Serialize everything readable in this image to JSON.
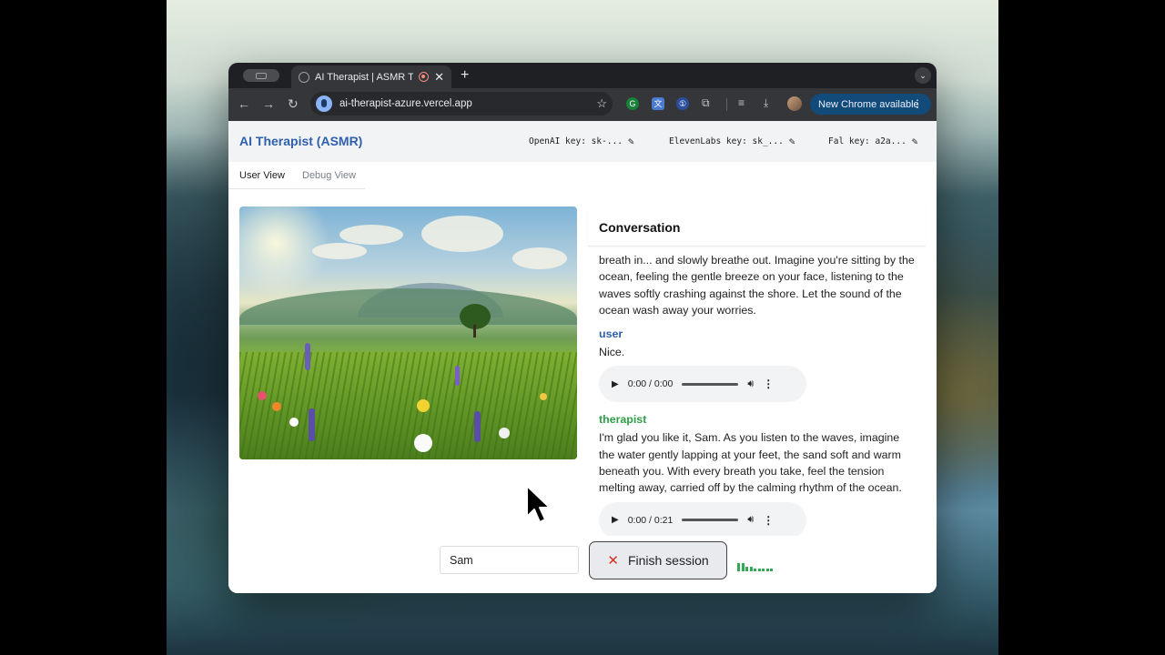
{
  "browser": {
    "tab_title": "AI Therapist | ASMR Thera",
    "url": "ai-therapist-azure.vercel.app",
    "update_label": "New Chrome available"
  },
  "app": {
    "title": "AI Therapist (ASMR)",
    "keys": {
      "openai": "OpenAI key: sk-...",
      "elevenlabs": "ElevenLabs key: sk_...",
      "fal": "Fal key: a2a..."
    },
    "view_tabs": {
      "user": "User View",
      "debug": "Debug View"
    }
  },
  "conversation": {
    "title": "Conversation",
    "messages": [
      {
        "role": "",
        "text": "breath in... and slowly breathe out. Imagine you're sitting by the ocean, feeling the gentle breeze on your face, listening to the waves softly crashing against the shore. Let the sound of the ocean wash away your worries."
      },
      {
        "role": "user",
        "text": "Nice.",
        "audio_time": "0:00 / 0:00"
      },
      {
        "role": "therapist",
        "text": "I'm glad you like it, Sam. As you listen to the waves, imagine the water gently lapping at your feet, the sand soft and warm beneath you. With every breath you take, feel the tension melting away, carried off by the calming rhythm of the ocean.",
        "audio_time": "0:00 / 0:21"
      }
    ]
  },
  "controls": {
    "name_value": "Sam",
    "finish_label": "Finish session",
    "level_bars": [
      0.9,
      0.9,
      0.5,
      0.5,
      0.3,
      0.3,
      0.3,
      0.3,
      0.3
    ]
  },
  "colors": {
    "accent_blue": "#2f5fad",
    "therapist_green": "#2f9e44",
    "finish_x_red": "#d93025",
    "level_green": "#34a853"
  }
}
